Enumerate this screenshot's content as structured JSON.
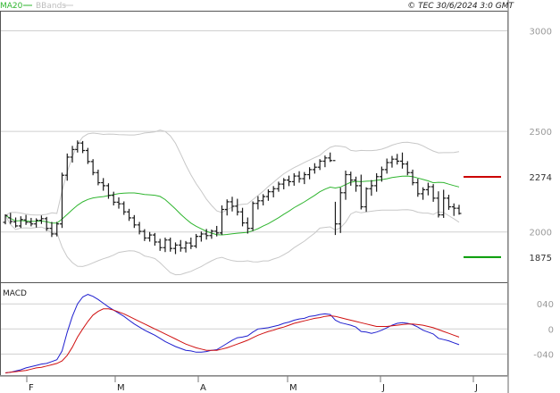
{
  "legend": {
    "ma": "MA20",
    "bands": "BBands"
  },
  "copyright": "© TEC 30/6/2024 3:0 GMT",
  "indicator_label": "MACD",
  "colors": {
    "ma": "#2fb52f",
    "bands": "#c8c8c8",
    "bar": "#1a1a1a",
    "macd": "#1f1fcf",
    "signal": "#d01010",
    "resistance": "#cc0000",
    "support": "#009900",
    "grid": "#cfcfcf"
  },
  "chart_data": [
    {
      "type": "ohlc",
      "x_labels": [
        "F",
        "M",
        "A",
        "M",
        "J",
        "J"
      ],
      "ylim": [
        1750,
        3100
      ],
      "y_ticks": [
        2000,
        2500,
        3000
      ],
      "y_tick_labels": [
        "2000",
        "2500",
        "3000"
      ],
      "grid": true,
      "levels": [
        {
          "label": "2274",
          "value": 2274,
          "kind": "resistance"
        },
        {
          "label": "1875",
          "value": 1875,
          "kind": "support"
        }
      ],
      "ohlc": [
        [
          2048,
          2088,
          2038,
          2082
        ],
        [
          2070,
          2095,
          2040,
          2052
        ],
        [
          2050,
          2072,
          2022,
          2030
        ],
        [
          2030,
          2078,
          2020,
          2062
        ],
        [
          2060,
          2085,
          2035,
          2048
        ],
        [
          2048,
          2070,
          2028,
          2040
        ],
        [
          2040,
          2068,
          2022,
          2058
        ],
        [
          2058,
          2082,
          2040,
          2066
        ],
        [
          2066,
          2075,
          2005,
          2018
        ],
        [
          2018,
          2050,
          1975,
          1990
        ],
        [
          1990,
          2050,
          1978,
          2040
        ],
        [
          2040,
          2295,
          2020,
          2282
        ],
        [
          2282,
          2390,
          2255,
          2372
        ],
        [
          2372,
          2428,
          2345,
          2410
        ],
        [
          2410,
          2455,
          2395,
          2442
        ],
        [
          2442,
          2452,
          2392,
          2405
        ],
        [
          2405,
          2418,
          2338,
          2350
        ],
        [
          2350,
          2362,
          2282,
          2295
        ],
        [
          2295,
          2310,
          2232,
          2245
        ],
        [
          2245,
          2268,
          2205,
          2230
        ],
        [
          2230,
          2242,
          2165,
          2182
        ],
        [
          2182,
          2200,
          2132,
          2148
        ],
        [
          2148,
          2172,
          2116,
          2140
        ],
        [
          2140,
          2152,
          2085,
          2100
        ],
        [
          2100,
          2115,
          2055,
          2070
        ],
        [
          2070,
          2084,
          2020,
          2035
        ],
        [
          2035,
          2050,
          1988,
          2003
        ],
        [
          2003,
          2014,
          1955,
          1970
        ],
        [
          1970,
          2000,
          1952,
          1985
        ],
        [
          1985,
          1995,
          1932,
          1950
        ],
        [
          1950,
          1966,
          1906,
          1922
        ],
        [
          1922,
          1972,
          1900,
          1960
        ],
        [
          1960,
          1972,
          1902,
          1918
        ],
        [
          1918,
          1948,
          1890,
          1935
        ],
        [
          1935,
          1960,
          1902,
          1920
        ],
        [
          1920,
          1955,
          1898,
          1945
        ],
        [
          1945,
          1972,
          1915,
          1930
        ],
        [
          1930,
          1990,
          1920,
          1978
        ],
        [
          1978,
          2002,
          1952,
          1990
        ],
        [
          1990,
          2015,
          1962,
          1982
        ],
        [
          1982,
          2012,
          1966,
          2004
        ],
        [
          2004,
          2030,
          1978,
          1995
        ],
        [
          1995,
          2132,
          1985,
          2112
        ],
        [
          2112,
          2162,
          2082,
          2150
        ],
        [
          2150,
          2175,
          2102,
          2128
        ],
        [
          2128,
          2165,
          2082,
          2100
        ],
        [
          2100,
          2120,
          2028,
          2045
        ],
        [
          2045,
          2072,
          1992,
          2018
        ],
        [
          2018,
          2152,
          2005,
          2142
        ],
        [
          2142,
          2178,
          2112,
          2155
        ],
        [
          2155,
          2188,
          2132,
          2176
        ],
        [
          2176,
          2212,
          2155,
          2200
        ],
        [
          2200,
          2228,
          2172,
          2215
        ],
        [
          2215,
          2250,
          2200,
          2238
        ],
        [
          2238,
          2268,
          2212,
          2258
        ],
        [
          2258,
          2280,
          2228,
          2250
        ],
        [
          2250,
          2292,
          2230,
          2278
        ],
        [
          2278,
          2302,
          2245,
          2265
        ],
        [
          2265,
          2298,
          2238,
          2285
        ],
        [
          2285,
          2322,
          2262,
          2310
        ],
        [
          2310,
          2342,
          2290,
          2322
        ],
        [
          2322,
          2362,
          2308,
          2352
        ],
        [
          2352,
          2380,
          2322,
          2368
        ],
        [
          2368,
          2395,
          2348,
          2355
        ],
        [
          2355,
          2150,
          1985,
          2040
        ],
        [
          2040,
          2220,
          1995,
          2195
        ],
        [
          2195,
          2305,
          2160,
          2285
        ],
        [
          2285,
          2300,
          2230,
          2258
        ],
        [
          2258,
          2275,
          2200,
          2230
        ],
        [
          2230,
          2285,
          2112,
          2125
        ],
        [
          2125,
          2222,
          2100,
          2215
        ],
        [
          2215,
          2258,
          2180,
          2230
        ],
        [
          2230,
          2292,
          2200,
          2275
        ],
        [
          2275,
          2325,
          2250,
          2310
        ],
        [
          2310,
          2365,
          2290,
          2345
        ],
        [
          2345,
          2378,
          2320,
          2362
        ],
        [
          2362,
          2388,
          2335,
          2352
        ],
        [
          2352,
          2395,
          2315,
          2338
        ],
        [
          2338,
          2352,
          2282,
          2295
        ],
        [
          2295,
          2310,
          2232,
          2245
        ],
        [
          2245,
          2265,
          2175,
          2190
        ],
        [
          2190,
          2222,
          2160,
          2210
        ],
        [
          2210,
          2245,
          2182,
          2225
        ],
        [
          2225,
          2238,
          2150,
          2168
        ],
        [
          2168,
          2202,
          2072,
          2085
        ],
        [
          2085,
          2210,
          2070,
          2168
        ],
        [
          2168,
          2185,
          2110,
          2125
        ],
        [
          2125,
          2142,
          2080,
          2118
        ],
        [
          2118,
          2135,
          2086,
          2092
        ]
      ]
    },
    {
      "type": "line",
      "title": "MACD",
      "ylim": [
        -75,
        73
      ],
      "y_ticks": [
        40,
        0,
        -40
      ],
      "y_tick_labels": [
        "040",
        "0",
        "-040"
      ],
      "series": [
        {
          "role": "macd",
          "values": [
            -70,
            -69,
            -67,
            -65,
            -62,
            -60,
            -58,
            -56,
            -55,
            -52,
            -49,
            -35,
            -5,
            20,
            40,
            51,
            55,
            52,
            47,
            41,
            35,
            30,
            25,
            20,
            14,
            8,
            3,
            -2,
            -6,
            -10,
            -15,
            -20,
            -24,
            -28,
            -31,
            -34,
            -35,
            -37,
            -37,
            -36,
            -34,
            -33,
            -28,
            -23,
            -18,
            -14,
            -13,
            -11,
            -5,
            0,
            1,
            2,
            4,
            6,
            9,
            11,
            14,
            16,
            17,
            20,
            21,
            23,
            24,
            23,
            14,
            10,
            8,
            6,
            3,
            -4,
            -5,
            -7,
            -5,
            -2,
            2,
            6,
            9,
            10,
            9,
            7,
            3,
            -2,
            -5,
            -8,
            -15,
            -17,
            -19,
            -22,
            -25
          ]
        },
        {
          "role": "signal",
          "values": [
            -70,
            -69,
            -68,
            -67,
            -66,
            -64,
            -62,
            -61,
            -59,
            -57,
            -55,
            -51,
            -42,
            -29,
            -13,
            0,
            12,
            22,
            28,
            32,
            32,
            30,
            27,
            24,
            20,
            16,
            12,
            8,
            4,
            0,
            -4,
            -8,
            -12,
            -16,
            -20,
            -24,
            -27,
            -30,
            -32,
            -34,
            -34,
            -34,
            -32,
            -30,
            -27,
            -24,
            -21,
            -18,
            -14,
            -10,
            -7,
            -4,
            -2,
            1,
            3,
            6,
            9,
            11,
            13,
            15,
            17,
            18,
            20,
            21,
            20,
            18,
            16,
            14,
            12,
            10,
            8,
            6,
            4,
            4,
            4,
            5,
            6,
            7,
            8,
            8,
            7,
            6,
            4,
            2,
            -1,
            -4,
            -7,
            -10,
            -13
          ]
        }
      ]
    }
  ]
}
